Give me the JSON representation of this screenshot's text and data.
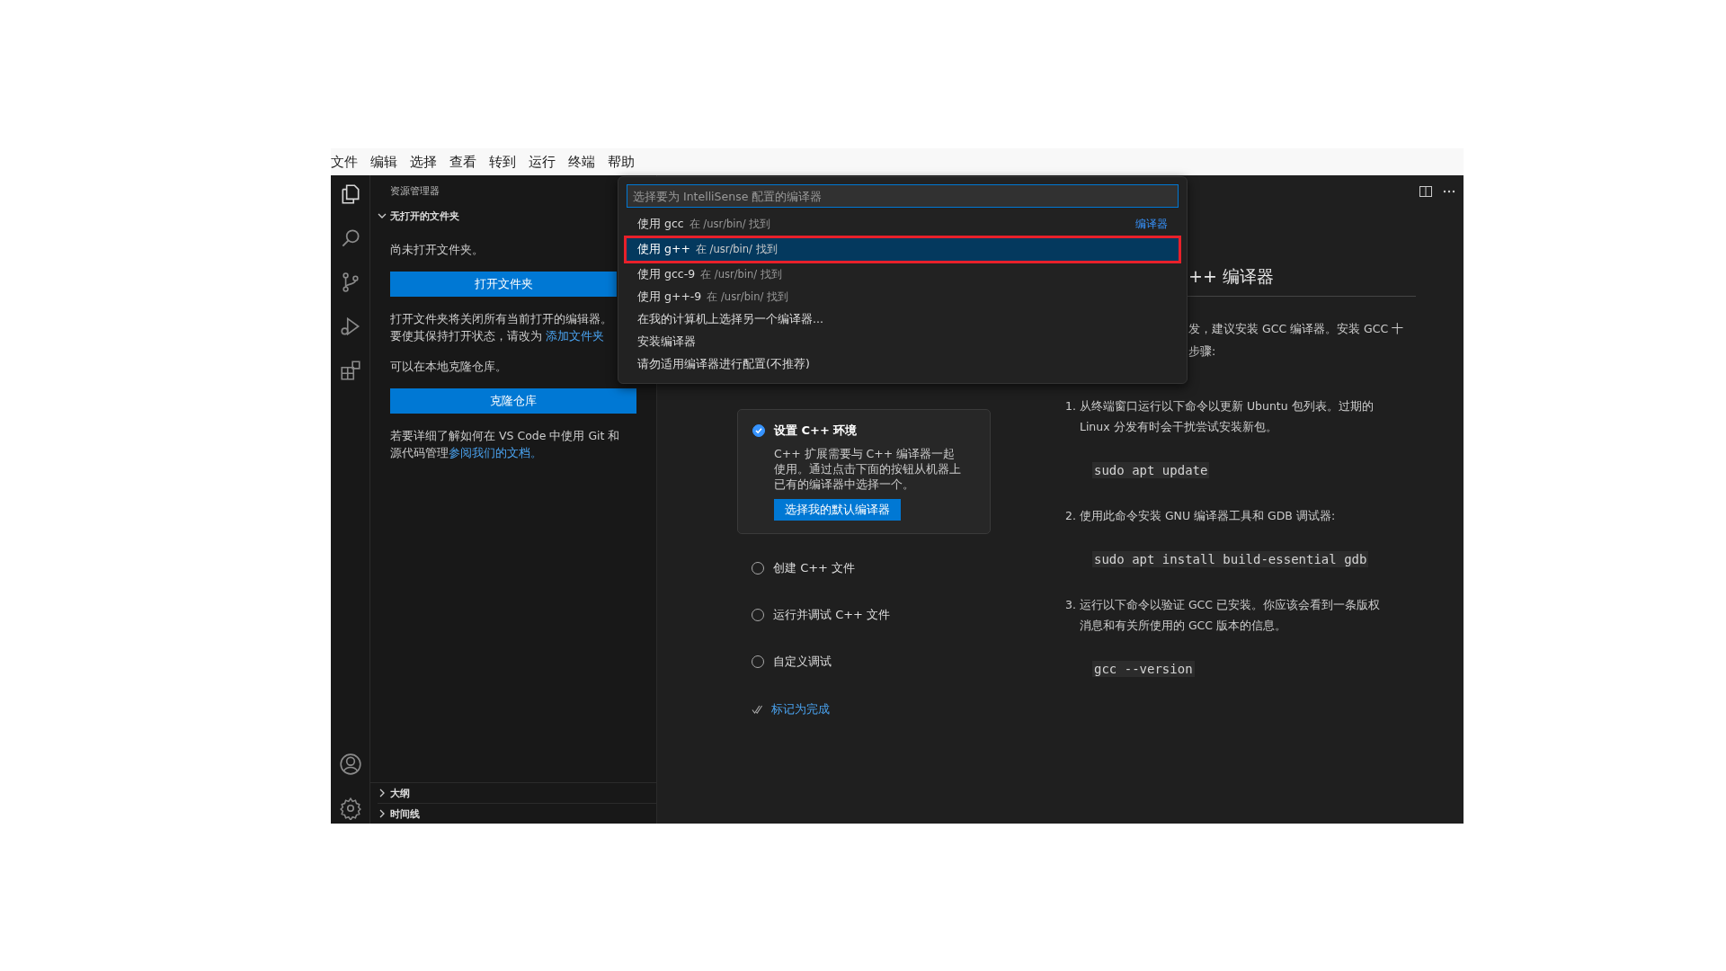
{
  "menu": [
    "文件",
    "编辑",
    "选择",
    "查看",
    "转到",
    "运行",
    "终端",
    "帮助"
  ],
  "sidebar": {
    "title": "资源管理器",
    "section": {
      "label": "无打开的文件夹",
      "expanded": true
    },
    "empty_text": "尚未打开文件夹。",
    "open_button": "打开文件夹",
    "open_note_line1": "打开文件夹将关闭所有当前打开的编辑器。",
    "open_note_line2": "要使其保持打开状态，请改为 ",
    "open_note_link": "添加文件夹",
    "clone_text": "可以在本地克隆仓库。",
    "clone_button": "克隆仓库",
    "git_note": "若要详细了解如何在 VS Code 中使用 Git 和源代码管理",
    "git_link": "参阅我们的文档。",
    "bottom_sections": [
      {
        "label": "大纲",
        "expanded": false
      },
      {
        "label": "时间线",
        "expanded": false
      }
    ]
  },
  "quick_pick": {
    "placeholder": "选择要为 IntelliSense 配置的编译器",
    "items": [
      {
        "label": "使用 gcc",
        "detail": "在 /usr/bin/ 找到",
        "group_label": "编译器",
        "selected": false,
        "annotated": false
      },
      {
        "label": "使用 g++",
        "detail": "在 /usr/bin/ 找到",
        "selected": true,
        "annotated": true
      },
      {
        "label": "使用 gcc-9",
        "detail": "在 /usr/bin/ 找到",
        "selected": false,
        "annotated": false
      },
      {
        "label": "使用 g++-9",
        "detail": "在 /usr/bin/ 找到",
        "selected": false,
        "annotated": false
      },
      {
        "label": "在我的计算机上选择另一个编译器...",
        "selected": false,
        "annotated": false
      },
      {
        "label": "安装编译器",
        "selected": false,
        "annotated": false
      },
      {
        "label": "请勿适用编译器进行配置(不推荐)",
        "selected": false,
        "annotated": false
      }
    ]
  },
  "walkthrough": {
    "steps": [
      {
        "title": "设置 C++ 环境",
        "checked": true,
        "expanded": true,
        "description": "C++ 扩展需要与 C++ 编译器一起使用。通过点击下面的按钮从机器上已有的编译器中选择一个。",
        "button": "选择我的默认编译器"
      },
      {
        "title": "创建 C++ 文件",
        "checked": false,
        "expanded": false
      },
      {
        "title": "运行并调试 C++ 文件",
        "checked": false,
        "expanded": false
      },
      {
        "title": "自定义调试",
        "checked": false,
        "expanded": false
      }
    ],
    "mark_done": "标记为完成"
  },
  "detail": {
    "heading": "++ 编译器",
    "intro_line1": "发，建议安装 GCC 编译器。安装 GCC 十",
    "intro_line2": "步骤:",
    "steps": [
      {
        "number": "1.",
        "text": "从终端窗口运行以下命令以更新 Ubuntu 包列表。过期的 Linux 分发有时会干扰尝试安装新包。",
        "code": "sudo apt update"
      },
      {
        "number": "2.",
        "text": "使用此命令安装 GNU 编译器工具和 GDB 调试器:",
        "code": "sudo apt install build-essential gdb"
      },
      {
        "number": "3.",
        "text": "运行以下命令以验证 GCC 已安装。你应该会看到一条版权消息和有关所使用的 GCC 版本的信息。",
        "code": "gcc --version"
      }
    ]
  }
}
